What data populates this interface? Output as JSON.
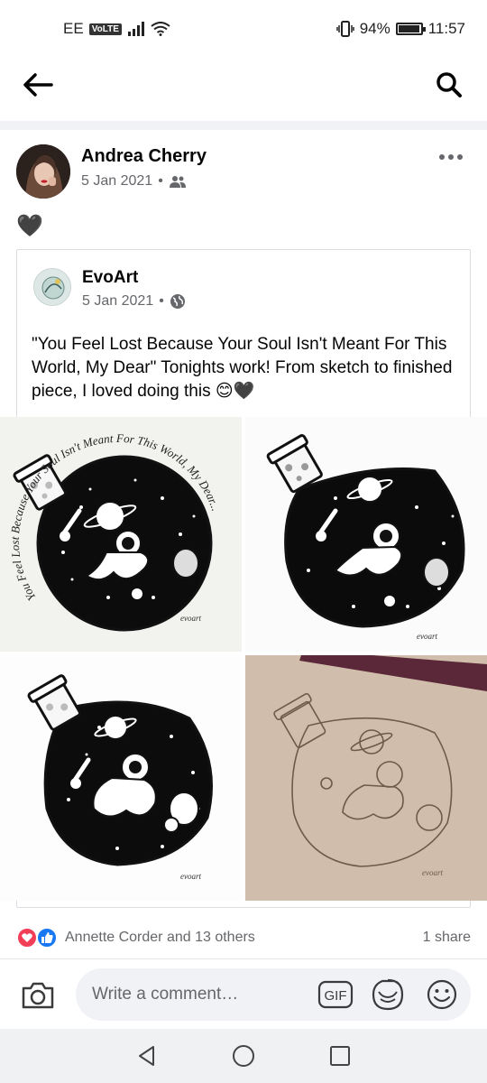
{
  "status_bar": {
    "carrier": "EE",
    "volte": "VoLTE",
    "battery": "94%",
    "battery_level": 0.94,
    "time": "11:57"
  },
  "post": {
    "author": "Andrea Cherry",
    "date": "5 Jan 2021",
    "audience_icon": "friends-icon",
    "body_emoji": "🖤"
  },
  "shared": {
    "page_name": "EvoArt",
    "date": "5 Jan 2021",
    "audience_icon": "globe-icon",
    "text": "\"You Feel Lost Because Your Soul Isn't Meant For This World, My Dear\" Tonights work! From sketch to finished piece, I loved doing this 😊🖤",
    "artwork_lettering": "You Feel Lost Because Your Soul Isn't Meant For This World, My Dear...",
    "signature": "evoart"
  },
  "reactions": {
    "summary": "Annette Corder and 13 others",
    "shares": "1 share",
    "icons": [
      "love-reaction-icon",
      "like-reaction-icon"
    ]
  },
  "composer": {
    "placeholder": "Write a comment…",
    "gif_label": "GIF"
  },
  "colors": {
    "accent": "#1877f2",
    "love": "#f33e58",
    "muted": "#65676b"
  }
}
